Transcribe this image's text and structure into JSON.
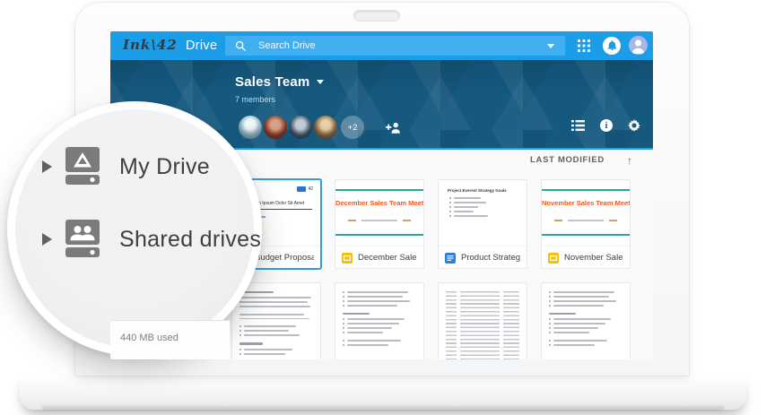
{
  "topbar": {
    "logo": "Ink\\42",
    "product": "Drive",
    "search_placeholder": "Search Drive"
  },
  "team": {
    "title": "Sales Team",
    "members_label": "7 members",
    "overflow_badge": "+2"
  },
  "sort": {
    "label": "LAST MODIFIED",
    "direction": "ascending"
  },
  "files": [
    {
      "name": "Budget Proposal Tem...",
      "type": "document",
      "selected": true,
      "preview": {
        "kind": "letter-doc",
        "title": "Lorem Ipsum Dolor Sit Amet",
        "logo_mark": "42"
      }
    },
    {
      "name": "December Sales Tea...",
      "type": "presentation",
      "selected": false,
      "preview": {
        "kind": "slide",
        "title": "December Sales Team Meeting"
      }
    },
    {
      "name": "Product Strategy Goa...",
      "type": "document",
      "selected": false,
      "preview": {
        "kind": "goals-doc",
        "title": "Project Everest Strategy Goals"
      }
    },
    {
      "name": "November Sales Tea...",
      "type": "presentation",
      "selected": false,
      "preview": {
        "kind": "slide",
        "title": "November Sales Team Meeting"
      }
    }
  ],
  "more_files_row": [
    {
      "preview": "text-document"
    },
    {
      "preview": "bullet-document"
    },
    {
      "preview": "spreadsheet"
    },
    {
      "preview": "bullet-document"
    }
  ],
  "magnifier": {
    "items": [
      {
        "label": "My Drive",
        "icon": "my-drive-icon"
      },
      {
        "label": "Shared drives",
        "icon": "shared-drives-icon"
      }
    ]
  },
  "storage": {
    "used_label": "440 MB used"
  },
  "colors": {
    "topbar_blue": "#1b9de8",
    "header_blue": "#15597f",
    "accent_underline": "#1e9fe9",
    "slide_orange": "#f4581f",
    "slide_teal": "#2aa89e",
    "slides_yellow": "#fbbc04",
    "docs_blue": "#2f7de1",
    "selected_border": "#2a9cf0"
  }
}
